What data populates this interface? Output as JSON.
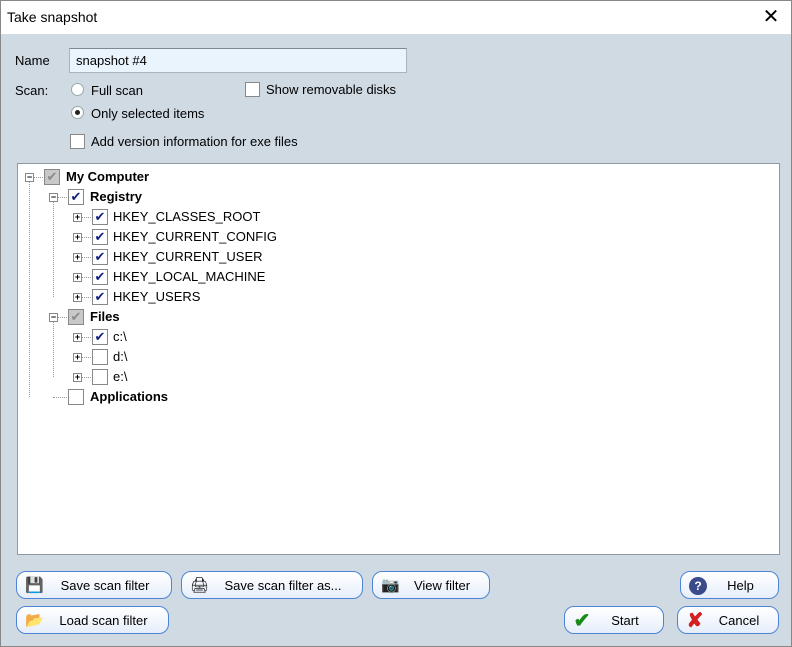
{
  "window": {
    "title": "Take snapshot"
  },
  "form": {
    "name_label": "Name",
    "name_value": "snapshot #4",
    "scan_label": "Scan:",
    "scan_options": [
      {
        "label": "Full scan",
        "selected": false
      },
      {
        "label": "Only selected items",
        "selected": true
      }
    ],
    "show_removable": {
      "label": "Show removable disks",
      "checked": false
    },
    "add_version": {
      "label": "Add version information for exe files",
      "checked": false
    }
  },
  "tree": [
    {
      "label": "My Computer",
      "level": 0,
      "expander": "minus",
      "state": "partial",
      "bold": true
    },
    {
      "label": "Registry",
      "level": 1,
      "expander": "minus",
      "state": "checked",
      "bold": true
    },
    {
      "label": "HKEY_CLASSES_ROOT",
      "level": 2,
      "expander": "plus",
      "state": "checked"
    },
    {
      "label": "HKEY_CURRENT_CONFIG",
      "level": 2,
      "expander": "plus",
      "state": "checked"
    },
    {
      "label": "HKEY_CURRENT_USER",
      "level": 2,
      "expander": "plus",
      "state": "checked"
    },
    {
      "label": "HKEY_LOCAL_MACHINE",
      "level": 2,
      "expander": "plus",
      "state": "checked"
    },
    {
      "label": "HKEY_USERS",
      "level": 2,
      "expander": "plus",
      "state": "checked"
    },
    {
      "label": "Files",
      "level": 1,
      "expander": "minus",
      "state": "partial",
      "bold": true
    },
    {
      "label": "c:\\",
      "level": 2,
      "expander": "plus",
      "state": "checked"
    },
    {
      "label": "d:\\",
      "level": 2,
      "expander": "plus",
      "state": "unchecked"
    },
    {
      "label": "e:\\",
      "level": 2,
      "expander": "plus",
      "state": "unchecked"
    },
    {
      "label": "Applications",
      "level": 1,
      "expander": "none",
      "state": "unchecked",
      "bold": true
    }
  ],
  "buttons": {
    "save_filter": {
      "label": "Save scan filter",
      "icon": "floppy-disk-icon"
    },
    "save_filter_as": {
      "label": "Save scan filter as...",
      "icon": "save-as-icon"
    },
    "view_filter": {
      "label": "View filter",
      "icon": "view-icon"
    },
    "help": {
      "label": "Help",
      "icon": "help-icon"
    },
    "load_filter": {
      "label": "Load scan filter",
      "icon": "folder-icon"
    },
    "start": {
      "label": "Start",
      "icon": "checkmark-icon",
      "color": "#1a8a1a"
    },
    "cancel": {
      "label": "Cancel",
      "icon": "x-icon",
      "color": "#d42020"
    }
  }
}
